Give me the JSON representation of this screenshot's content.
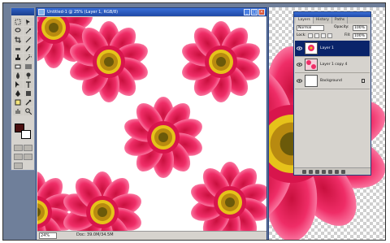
{
  "document": {
    "title": "Untitled-1 @ 25% (Layer 1, RGB/8)",
    "zoom": "24%",
    "info": "Doc: 39.0M/34.5M"
  },
  "layers_panel": {
    "tabs": [
      "Layers",
      "History",
      "Paths"
    ],
    "blend_mode": "Normal",
    "opacity_label": "Opacity:",
    "opacity": "100%",
    "lock_label": "Lock:",
    "fill_label": "Fill:",
    "fill": "100%",
    "layers": [
      {
        "name": "Layer 1",
        "selected": true
      },
      {
        "name": "Layer 1 copy 4",
        "selected": false
      },
      {
        "name": "Background",
        "selected": false
      }
    ]
  },
  "toolbox": {
    "foreground_color": "#4b0f10",
    "background_color": "#ffffff"
  },
  "colors": {
    "petal": "#e8245e",
    "petal_light": "#ff8fb0",
    "center": "#e6c21a",
    "title_bar": "#2049a6",
    "selected_layer": "#0a246a"
  }
}
